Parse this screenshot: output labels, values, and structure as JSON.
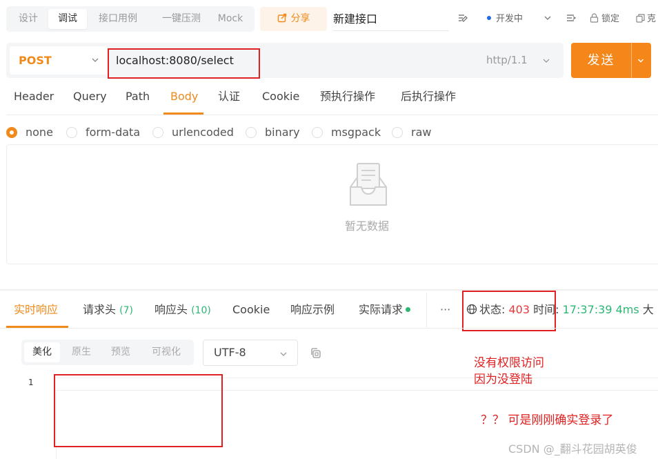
{
  "top": {
    "modes": [
      "设计",
      "调试",
      "接口用例",
      "一键压测",
      "Mock"
    ],
    "active_mode": "调试",
    "share_label": "分享",
    "api_name": "新建接口",
    "status_label": "开发中",
    "lock_label": "锁定",
    "clone_label": "克"
  },
  "request": {
    "method": "POST",
    "url": "localhost:8080/select",
    "protocol": "http/1.1",
    "send_label": "发送"
  },
  "request_tabs": [
    "Header",
    "Query",
    "Path",
    "Body",
    "认证",
    "Cookie",
    "预执行操作",
    "后执行操作"
  ],
  "active_request_tab": "Body",
  "body_types": [
    "none",
    "form-data",
    "urlencoded",
    "binary",
    "msgpack",
    "raw"
  ],
  "selected_body_type": "none",
  "empty_text": "暂无数据",
  "response": {
    "tabs": {
      "realtime": "实时响应",
      "req_headers": "请求头",
      "req_headers_count": "(7)",
      "resp_headers": "响应头",
      "resp_headers_count": "(10)",
      "cookie": "Cookie",
      "example": "响应示例",
      "actual": "实际请求"
    },
    "more": "···",
    "status_label": "状态:",
    "status_code": "403",
    "time_label": "时间:",
    "time_value": "17:37:39",
    "duration": "4ms",
    "size_label": "大",
    "views": [
      "美化",
      "原生",
      "预览",
      "可视化"
    ],
    "active_view": "美化",
    "encoding": "UTF-8",
    "line_number": "1"
  },
  "annotations": {
    "line1": "没有权限访问",
    "line2": "因为没登陆",
    "line3": "？？ 可是刚刚确实登录了"
  },
  "watermark": "CSDN @_翻斗花园胡英俊"
}
